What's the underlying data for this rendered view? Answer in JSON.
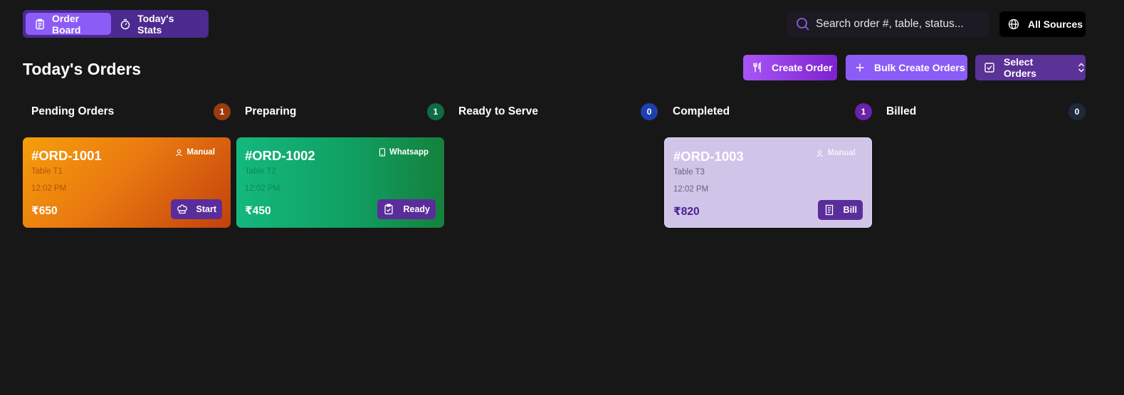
{
  "tabs": [
    {
      "label": "Order Board",
      "icon": "clipboard-icon",
      "active": true
    },
    {
      "label": "Today's Stats",
      "icon": "stopwatch-icon",
      "active": false
    }
  ],
  "search": {
    "placeholder": "Search order #, table, status..."
  },
  "sources": {
    "label": "All Sources",
    "icon": "globe-icon"
  },
  "page_title": "Today's Orders",
  "actions": {
    "create": "Create Order",
    "bulk": "Bulk Create Orders",
    "select": "Select Orders"
  },
  "columns": [
    {
      "title": "Pending Orders",
      "count": "1",
      "color": "#9a3c0f"
    },
    {
      "title": "Preparing",
      "count": "1",
      "color": "#0f6b45"
    },
    {
      "title": "Ready to Serve",
      "count": "0",
      "color": "#1e40af"
    },
    {
      "title": "Completed",
      "count": "1",
      "color": "#6b21a8"
    },
    {
      "title": "Billed",
      "count": "0",
      "color": "#1e293b"
    }
  ],
  "orders": [
    {
      "id": "#ORD-1001",
      "source": "Manual",
      "table": "Table T1",
      "time": "12:02 PM",
      "amount": "₹650",
      "action": "Start"
    },
    {
      "id": "#ORD-1002",
      "source": "Whatsapp",
      "table": "Table T2",
      "time": "12:02 PM",
      "amount": "₹450",
      "action": "Ready"
    },
    {
      "id": "#ORD-1003",
      "source": "Manual",
      "table": "Table T3",
      "time": "12:02 PM",
      "amount": "₹820",
      "action": "Bill"
    }
  ]
}
